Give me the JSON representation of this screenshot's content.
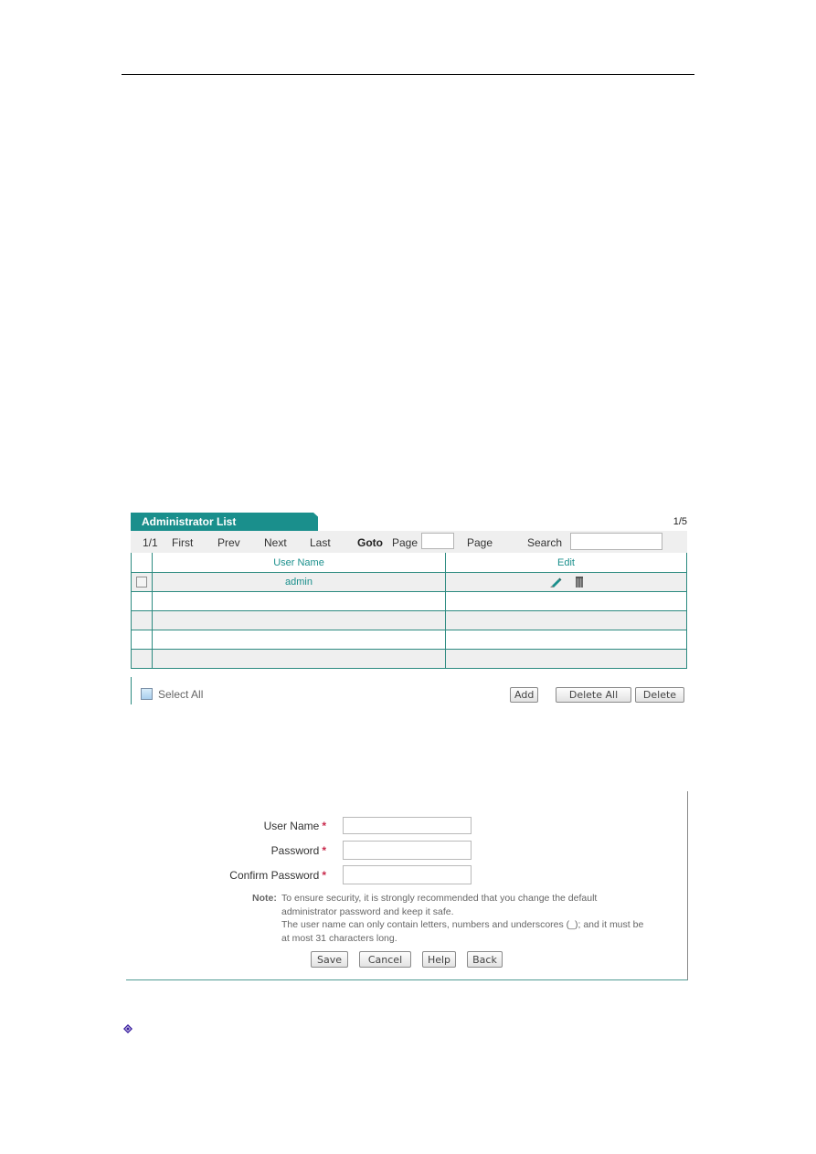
{
  "admin_list": {
    "title": "Administrator List",
    "page_count": "1/5",
    "toolbar": {
      "page_indicator": "1/1",
      "first": "First",
      "prev": "Prev",
      "next": "Next",
      "last": "Last",
      "goto": "Goto",
      "page_before": "Page",
      "page_input_value": "",
      "page_after": "Page",
      "search_label": "Search",
      "search_value": ""
    },
    "columns": [
      "User Name",
      "Edit"
    ],
    "rows": [
      {
        "user_name": "admin",
        "checked": false,
        "has_actions": true
      },
      {
        "user_name": "",
        "checked": false,
        "has_actions": false
      },
      {
        "user_name": "",
        "checked": false,
        "has_actions": false
      },
      {
        "user_name": "",
        "checked": false,
        "has_actions": false
      },
      {
        "user_name": "",
        "checked": false,
        "has_actions": false
      }
    ],
    "select_all_label": "Select All",
    "buttons": {
      "add": "Add",
      "delete_all": "Delete All",
      "delete": "Delete"
    },
    "icons": {
      "edit": "edit-pencil-icon",
      "delete": "trash-icon"
    }
  },
  "admin_form": {
    "fields": [
      {
        "label": "User Name",
        "required": "*",
        "value": ""
      },
      {
        "label": "Password",
        "required": "*",
        "value": ""
      },
      {
        "label": "Confirm Password",
        "required": "*",
        "value": ""
      }
    ],
    "note_label": "Note:",
    "note_lines": [
      "To ensure security, it is strongly recommended that you change the default",
      "administrator password and keep it safe.",
      "The user name can only contain letters, numbers and underscores (_); and it must be",
      "at most 31 characters long."
    ],
    "buttons": {
      "save": "Save",
      "cancel": "Cancel",
      "help": "Help",
      "back": "Back"
    }
  },
  "bullet_icon": "diamond-bullet-icon",
  "colors": {
    "accent": "#1a8f8c",
    "grid_border": "#2c8a80",
    "required": "#c8284a",
    "bullet": "#3a1fa0"
  }
}
